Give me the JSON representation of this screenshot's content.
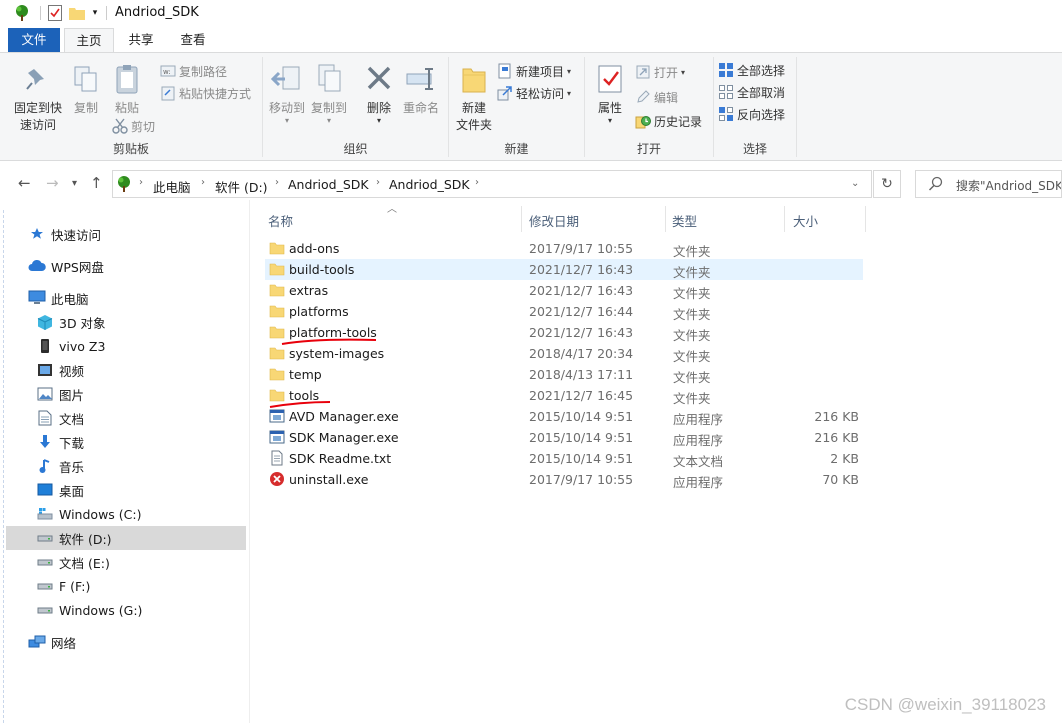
{
  "window": {
    "title": "Andriod_SDK"
  },
  "ribbon_tabs": {
    "file": "文件",
    "home": "主页",
    "share": "共享",
    "view": "查看"
  },
  "ribbon": {
    "clipboard": {
      "label": "剪贴板",
      "pin": "固定到快\n速访问",
      "copy": "复制",
      "paste": "粘贴",
      "copy_path": "复制路径",
      "paste_shortcut": "粘贴快捷方式",
      "cut": "剪切"
    },
    "organize": {
      "label": "组织",
      "move_to": "移动到",
      "copy_to": "复制到",
      "delete": "删除",
      "rename": "重命名"
    },
    "new": {
      "label": "新建",
      "new_folder": "新建\n文件夹",
      "new_item": "新建项目",
      "easy_access": "轻松访问"
    },
    "open": {
      "label": "打开",
      "properties": "属性",
      "open": "打开",
      "edit": "编辑",
      "history": "历史记录"
    },
    "select": {
      "label": "选择",
      "select_all": "全部选择",
      "select_none": "全部取消",
      "invert": "反向选择"
    }
  },
  "address": {
    "crumbs": [
      "此电脑",
      "软件 (D:)",
      "Andriod_SDK",
      "Andriod_SDK"
    ],
    "search_placeholder": "搜索\"Andriod_SDK\""
  },
  "nav": {
    "quick_access": "快速访问",
    "wps": "WPS网盘",
    "this_pc": "此电脑",
    "items": [
      "3D 对象",
      "vivo Z3",
      "视频",
      "图片",
      "文档",
      "下载",
      "音乐",
      "桌面",
      "Windows (C:)",
      "软件 (D:)",
      "文档 (E:)",
      "F (F:)",
      "Windows (G:)"
    ],
    "network": "网络",
    "selected": "软件 (D:)"
  },
  "columns": {
    "name": "名称",
    "date": "修改日期",
    "type": "类型",
    "size": "大小"
  },
  "files": [
    {
      "name": "add-ons",
      "date": "2017/9/17 10:55",
      "type": "文件夹",
      "size": "",
      "icon": "folder-icon"
    },
    {
      "name": "build-tools",
      "date": "2021/12/7 16:43",
      "type": "文件夹",
      "size": "",
      "icon": "folder-icon"
    },
    {
      "name": "extras",
      "date": "2021/12/7 16:43",
      "type": "文件夹",
      "size": "",
      "icon": "folder-icon"
    },
    {
      "name": "platforms",
      "date": "2021/12/7 16:44",
      "type": "文件夹",
      "size": "",
      "icon": "folder-icon"
    },
    {
      "name": "platform-tools",
      "date": "2021/12/7 16:43",
      "type": "文件夹",
      "size": "",
      "icon": "folder-icon"
    },
    {
      "name": "system-images",
      "date": "2018/4/17 20:34",
      "type": "文件夹",
      "size": "",
      "icon": "folder-icon"
    },
    {
      "name": "temp",
      "date": "2018/4/13 17:11",
      "type": "文件夹",
      "size": "",
      "icon": "folder-icon"
    },
    {
      "name": "tools",
      "date": "2021/12/7 16:45",
      "type": "文件夹",
      "size": "",
      "icon": "folder-icon"
    },
    {
      "name": "AVD Manager.exe",
      "date": "2015/10/14 9:51",
      "type": "应用程序",
      "size": "216 KB",
      "icon": "exe-icon"
    },
    {
      "name": "SDK Manager.exe",
      "date": "2015/10/14 9:51",
      "type": "应用程序",
      "size": "216 KB",
      "icon": "exe-icon"
    },
    {
      "name": "SDK Readme.txt",
      "date": "2015/10/14 9:51",
      "type": "文本文档",
      "size": "2 KB",
      "icon": "text-file-icon"
    },
    {
      "name": "uninstall.exe",
      "date": "2017/9/17 10:55",
      "type": "应用程序",
      "size": "70 KB",
      "icon": "uninstall-icon"
    }
  ],
  "hovered_row": "build-tools",
  "annotated_rows": [
    "platform-tools",
    "tools"
  ],
  "watermark": "CSDN @weixin_39118023",
  "colors": {
    "file_tab": "#1c62b9",
    "folder": "#f8d775",
    "hover": "#e5f3ff",
    "annotation": "#e8000b"
  }
}
